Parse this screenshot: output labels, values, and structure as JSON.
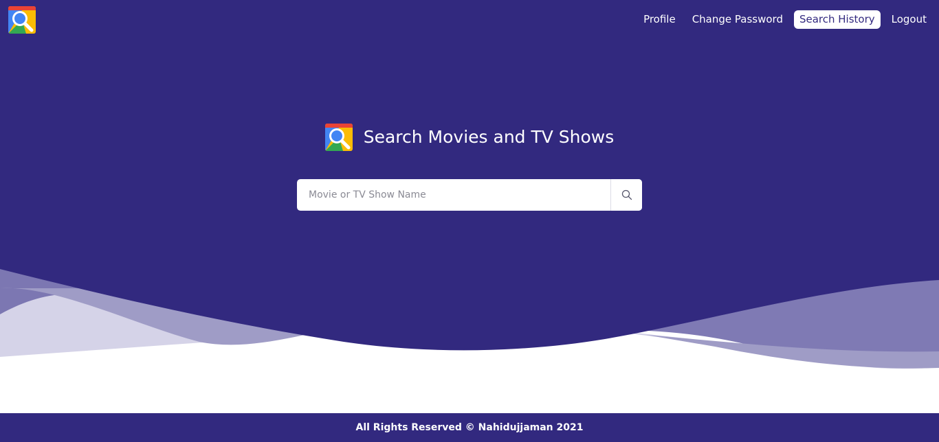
{
  "app": {
    "logo_icon": "search-magnifier-logo-icon"
  },
  "nav": {
    "items": [
      {
        "label": "Profile",
        "active": false
      },
      {
        "label": "Change Password",
        "active": false
      },
      {
        "label": "Search History",
        "active": true
      },
      {
        "label": "Logout",
        "active": false
      }
    ]
  },
  "hero": {
    "title": "Search Movies and TV Shows",
    "search": {
      "placeholder": "Movie or TV Show Name",
      "value": "",
      "button_icon": "search-icon"
    }
  },
  "footer": {
    "text": "All Rights Reserved © Nahidujjaman 2021"
  },
  "colors": {
    "primary": "#32297f",
    "wave_light": "#9f9cc6",
    "background": "#ffffff"
  }
}
